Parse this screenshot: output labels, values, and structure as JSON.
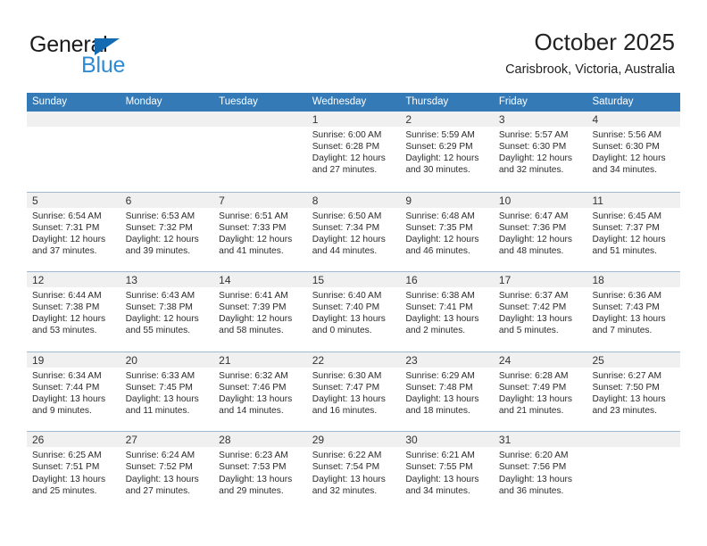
{
  "brand": {
    "name_top": "General",
    "name_bottom": "Blue",
    "accent_color": "#2e8bd4",
    "triangle_color": "#156bb1"
  },
  "header": {
    "title": "October 2025",
    "subtitle": "Carisbrook, Victoria, Australia"
  },
  "calendar": {
    "header_bg": "#337ab7",
    "weekdays": [
      "Sunday",
      "Monday",
      "Tuesday",
      "Wednesday",
      "Thursday",
      "Friday",
      "Saturday"
    ],
    "labels": {
      "sunrise": "Sunrise:",
      "sunset": "Sunset:",
      "daylight": "Daylight:"
    },
    "weeks": [
      [
        {
          "day": ""
        },
        {
          "day": ""
        },
        {
          "day": ""
        },
        {
          "day": "1",
          "sunrise": "Sunrise: 6:00 AM",
          "sunset": "Sunset: 6:28 PM",
          "daylight1": "Daylight: 12 hours",
          "daylight2": "and 27 minutes."
        },
        {
          "day": "2",
          "sunrise": "Sunrise: 5:59 AM",
          "sunset": "Sunset: 6:29 PM",
          "daylight1": "Daylight: 12 hours",
          "daylight2": "and 30 minutes."
        },
        {
          "day": "3",
          "sunrise": "Sunrise: 5:57 AM",
          "sunset": "Sunset: 6:30 PM",
          "daylight1": "Daylight: 12 hours",
          "daylight2": "and 32 minutes."
        },
        {
          "day": "4",
          "sunrise": "Sunrise: 5:56 AM",
          "sunset": "Sunset: 6:30 PM",
          "daylight1": "Daylight: 12 hours",
          "daylight2": "and 34 minutes."
        }
      ],
      [
        {
          "day": "5",
          "sunrise": "Sunrise: 6:54 AM",
          "sunset": "Sunset: 7:31 PM",
          "daylight1": "Daylight: 12 hours",
          "daylight2": "and 37 minutes."
        },
        {
          "day": "6",
          "sunrise": "Sunrise: 6:53 AM",
          "sunset": "Sunset: 7:32 PM",
          "daylight1": "Daylight: 12 hours",
          "daylight2": "and 39 minutes."
        },
        {
          "day": "7",
          "sunrise": "Sunrise: 6:51 AM",
          "sunset": "Sunset: 7:33 PM",
          "daylight1": "Daylight: 12 hours",
          "daylight2": "and 41 minutes."
        },
        {
          "day": "8",
          "sunrise": "Sunrise: 6:50 AM",
          "sunset": "Sunset: 7:34 PM",
          "daylight1": "Daylight: 12 hours",
          "daylight2": "and 44 minutes."
        },
        {
          "day": "9",
          "sunrise": "Sunrise: 6:48 AM",
          "sunset": "Sunset: 7:35 PM",
          "daylight1": "Daylight: 12 hours",
          "daylight2": "and 46 minutes."
        },
        {
          "day": "10",
          "sunrise": "Sunrise: 6:47 AM",
          "sunset": "Sunset: 7:36 PM",
          "daylight1": "Daylight: 12 hours",
          "daylight2": "and 48 minutes."
        },
        {
          "day": "11",
          "sunrise": "Sunrise: 6:45 AM",
          "sunset": "Sunset: 7:37 PM",
          "daylight1": "Daylight: 12 hours",
          "daylight2": "and 51 minutes."
        }
      ],
      [
        {
          "day": "12",
          "sunrise": "Sunrise: 6:44 AM",
          "sunset": "Sunset: 7:38 PM",
          "daylight1": "Daylight: 12 hours",
          "daylight2": "and 53 minutes."
        },
        {
          "day": "13",
          "sunrise": "Sunrise: 6:43 AM",
          "sunset": "Sunset: 7:38 PM",
          "daylight1": "Daylight: 12 hours",
          "daylight2": "and 55 minutes."
        },
        {
          "day": "14",
          "sunrise": "Sunrise: 6:41 AM",
          "sunset": "Sunset: 7:39 PM",
          "daylight1": "Daylight: 12 hours",
          "daylight2": "and 58 minutes."
        },
        {
          "day": "15",
          "sunrise": "Sunrise: 6:40 AM",
          "sunset": "Sunset: 7:40 PM",
          "daylight1": "Daylight: 13 hours",
          "daylight2": "and 0 minutes."
        },
        {
          "day": "16",
          "sunrise": "Sunrise: 6:38 AM",
          "sunset": "Sunset: 7:41 PM",
          "daylight1": "Daylight: 13 hours",
          "daylight2": "and 2 minutes."
        },
        {
          "day": "17",
          "sunrise": "Sunrise: 6:37 AM",
          "sunset": "Sunset: 7:42 PM",
          "daylight1": "Daylight: 13 hours",
          "daylight2": "and 5 minutes."
        },
        {
          "day": "18",
          "sunrise": "Sunrise: 6:36 AM",
          "sunset": "Sunset: 7:43 PM",
          "daylight1": "Daylight: 13 hours",
          "daylight2": "and 7 minutes."
        }
      ],
      [
        {
          "day": "19",
          "sunrise": "Sunrise: 6:34 AM",
          "sunset": "Sunset: 7:44 PM",
          "daylight1": "Daylight: 13 hours",
          "daylight2": "and 9 minutes."
        },
        {
          "day": "20",
          "sunrise": "Sunrise: 6:33 AM",
          "sunset": "Sunset: 7:45 PM",
          "daylight1": "Daylight: 13 hours",
          "daylight2": "and 11 minutes."
        },
        {
          "day": "21",
          "sunrise": "Sunrise: 6:32 AM",
          "sunset": "Sunset: 7:46 PM",
          "daylight1": "Daylight: 13 hours",
          "daylight2": "and 14 minutes."
        },
        {
          "day": "22",
          "sunrise": "Sunrise: 6:30 AM",
          "sunset": "Sunset: 7:47 PM",
          "daylight1": "Daylight: 13 hours",
          "daylight2": "and 16 minutes."
        },
        {
          "day": "23",
          "sunrise": "Sunrise: 6:29 AM",
          "sunset": "Sunset: 7:48 PM",
          "daylight1": "Daylight: 13 hours",
          "daylight2": "and 18 minutes."
        },
        {
          "day": "24",
          "sunrise": "Sunrise: 6:28 AM",
          "sunset": "Sunset: 7:49 PM",
          "daylight1": "Daylight: 13 hours",
          "daylight2": "and 21 minutes."
        },
        {
          "day": "25",
          "sunrise": "Sunrise: 6:27 AM",
          "sunset": "Sunset: 7:50 PM",
          "daylight1": "Daylight: 13 hours",
          "daylight2": "and 23 minutes."
        }
      ],
      [
        {
          "day": "26",
          "sunrise": "Sunrise: 6:25 AM",
          "sunset": "Sunset: 7:51 PM",
          "daylight1": "Daylight: 13 hours",
          "daylight2": "and 25 minutes."
        },
        {
          "day": "27",
          "sunrise": "Sunrise: 6:24 AM",
          "sunset": "Sunset: 7:52 PM",
          "daylight1": "Daylight: 13 hours",
          "daylight2": "and 27 minutes."
        },
        {
          "day": "28",
          "sunrise": "Sunrise: 6:23 AM",
          "sunset": "Sunset: 7:53 PM",
          "daylight1": "Daylight: 13 hours",
          "daylight2": "and 29 minutes."
        },
        {
          "day": "29",
          "sunrise": "Sunrise: 6:22 AM",
          "sunset": "Sunset: 7:54 PM",
          "daylight1": "Daylight: 13 hours",
          "daylight2": "and 32 minutes."
        },
        {
          "day": "30",
          "sunrise": "Sunrise: 6:21 AM",
          "sunset": "Sunset: 7:55 PM",
          "daylight1": "Daylight: 13 hours",
          "daylight2": "and 34 minutes."
        },
        {
          "day": "31",
          "sunrise": "Sunrise: 6:20 AM",
          "sunset": "Sunset: 7:56 PM",
          "daylight1": "Daylight: 13 hours",
          "daylight2": "and 36 minutes."
        },
        {
          "day": ""
        }
      ]
    ]
  }
}
